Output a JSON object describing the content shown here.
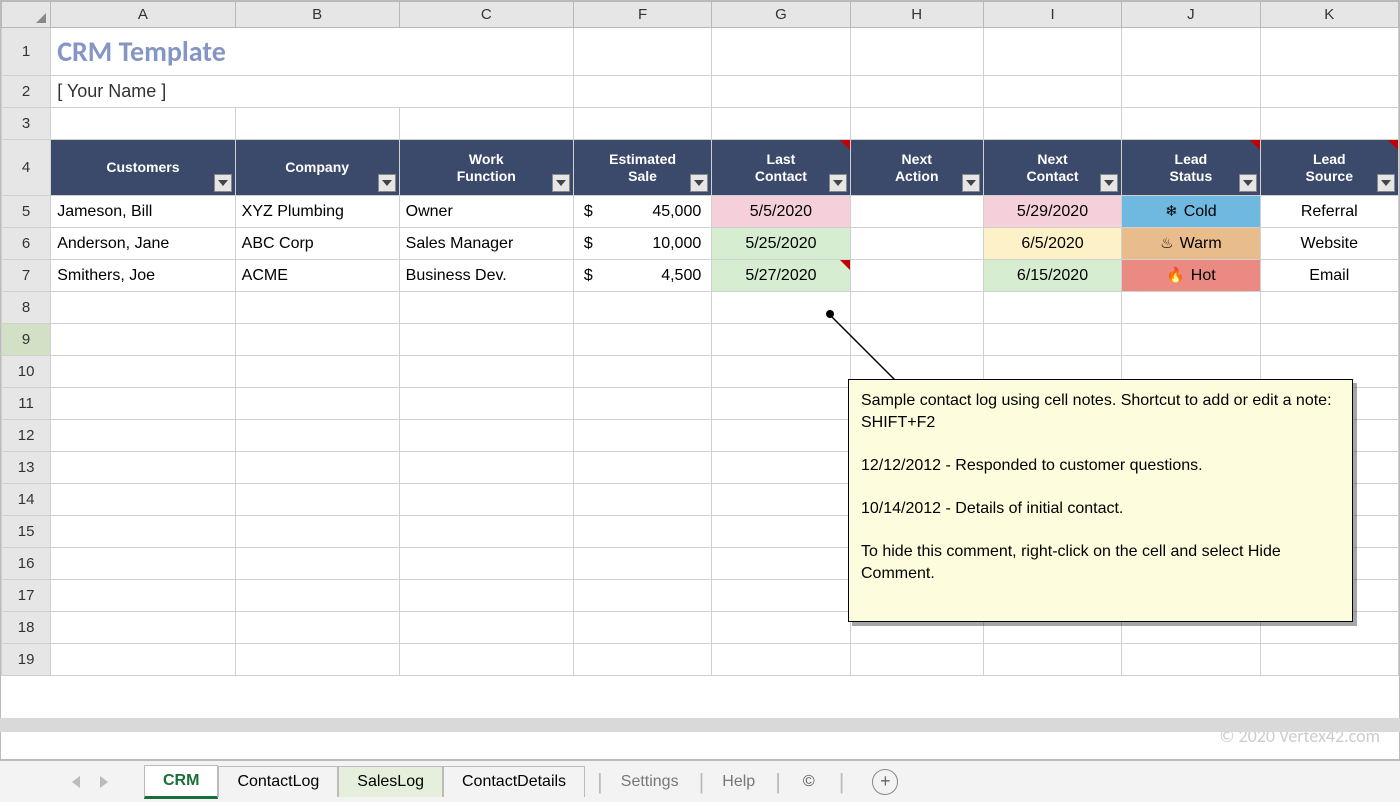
{
  "columns": [
    "A",
    "B",
    "C",
    "F",
    "G",
    "H",
    "I",
    "J",
    "K"
  ],
  "title": "CRM Template",
  "subtitle": "[ Your Name ]",
  "headers": {
    "customers": [
      "Customers",
      ""
    ],
    "company": [
      "Company",
      ""
    ],
    "work": [
      "Work",
      "Function"
    ],
    "sale": [
      "Estimated",
      "Sale"
    ],
    "lastc": [
      "Last",
      "Contact"
    ],
    "nexta": [
      "Next",
      "Action"
    ],
    "nextc": [
      "Next",
      "Contact"
    ],
    "status": [
      "Lead",
      "Status"
    ],
    "source": [
      "Lead",
      "Source"
    ]
  },
  "row_numbers": [
    1,
    2,
    3,
    4,
    5,
    6,
    7,
    8,
    9,
    10,
    11,
    12,
    13,
    14,
    15,
    16,
    17,
    18,
    19
  ],
  "selected_row": 9,
  "data_rows": [
    {
      "customers": "Jameson, Bill",
      "company": "XYZ Plumbing",
      "work": "Owner",
      "sale": "45,000",
      "lastc": "5/5/2020",
      "lastc_bg": "pink",
      "nexta": "",
      "nextc": "5/29/2020",
      "nextc_bg": "pink",
      "status": "Cold",
      "status_bg": "cold",
      "status_icon": "❄",
      "source": "Referral"
    },
    {
      "customers": "Anderson, Jane",
      "company": "ABC Corp",
      "work": "Sales Manager",
      "sale": "10,000",
      "lastc": "5/25/2020",
      "lastc_bg": "green",
      "nexta": "",
      "nextc": "6/5/2020",
      "nextc_bg": "yellow",
      "status": "Warm",
      "status_bg": "warm",
      "status_icon": "♨",
      "source": "Website"
    },
    {
      "customers": "Smithers, Joe",
      "company": "ACME",
      "work": "Business Dev.",
      "sale": "4,500",
      "lastc": "5/27/2020",
      "lastc_bg": "green",
      "nexta": "",
      "nextc": "6/15/2020",
      "nextc_bg": "green",
      "status": "Hot",
      "status_bg": "hot",
      "status_icon": "🔥",
      "source": "Email",
      "has_note": true
    }
  ],
  "comment_text": "Sample contact log using cell notes. Shortcut to add or edit a note: SHIFT+F2\n\n12/12/2012 - Responded to customer questions.\n\n10/14/2012 - Details of initial contact.\n\nTo hide this comment, right-click on the cell and select Hide Comment.",
  "watermark": "© 2020 Vertex42.com",
  "tabs": {
    "crm": "CRM",
    "contactlog": "ContactLog",
    "saleslog": "SalesLog",
    "contactdetails": "ContactDetails",
    "settings": "Settings",
    "help": "Help",
    "copyright": "©"
  }
}
